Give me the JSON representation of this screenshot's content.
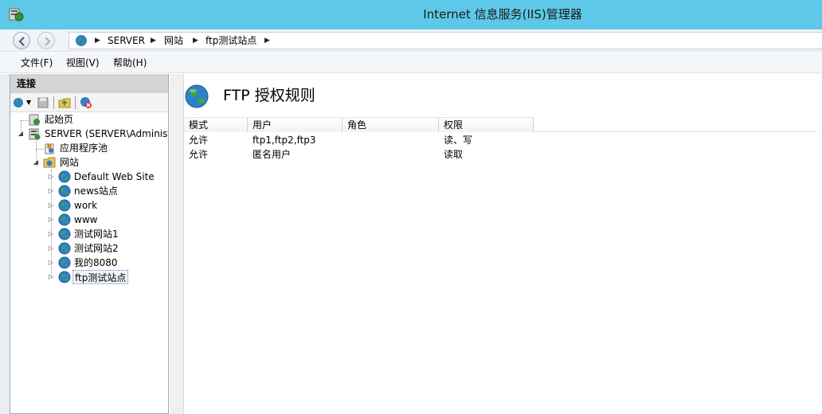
{
  "window": {
    "title": "Internet 信息服务(IIS)管理器"
  },
  "address": {
    "crumbs": [
      "SERVER",
      "网站",
      "ftp测试站点"
    ]
  },
  "menu": {
    "items": [
      "文件(F)",
      "视图(V)",
      "帮助(H)"
    ]
  },
  "connections": {
    "title": "连接",
    "tree": [
      {
        "label": "起始页",
        "icon": "start-page-icon"
      },
      {
        "label": "SERVER (SERVER\\Administrator)",
        "icon": "server-icon"
      },
      {
        "label": "应用程序池",
        "icon": "app-pool-icon"
      },
      {
        "label": "网站",
        "icon": "sites-folder-icon"
      },
      {
        "label": "Default Web Site",
        "icon": "globe-icon"
      },
      {
        "label": "news站点",
        "icon": "globe-icon"
      },
      {
        "label": "work",
        "icon": "globe-icon"
      },
      {
        "label": "www",
        "icon": "globe-icon"
      },
      {
        "label": "测试网站1",
        "icon": "globe-icon"
      },
      {
        "label": "测试网站2",
        "icon": "globe-icon"
      },
      {
        "label": "我的8080",
        "icon": "globe-icon"
      },
      {
        "label": "ftp测试站点",
        "icon": "globe-icon"
      }
    ]
  },
  "page": {
    "title": "FTP 授权规则",
    "columns": [
      "模式",
      "用户",
      "角色",
      "权限"
    ],
    "rows": [
      {
        "mode": "允许",
        "users": "ftp1,ftp2,ftp3",
        "roles": "",
        "perms": "读、写"
      },
      {
        "mode": "允许",
        "users": "匿名用户",
        "roles": "",
        "perms": "读取"
      }
    ]
  },
  "colors": {
    "titlebar": "#5ec8e8",
    "header_gray": "#d4d4d4"
  }
}
